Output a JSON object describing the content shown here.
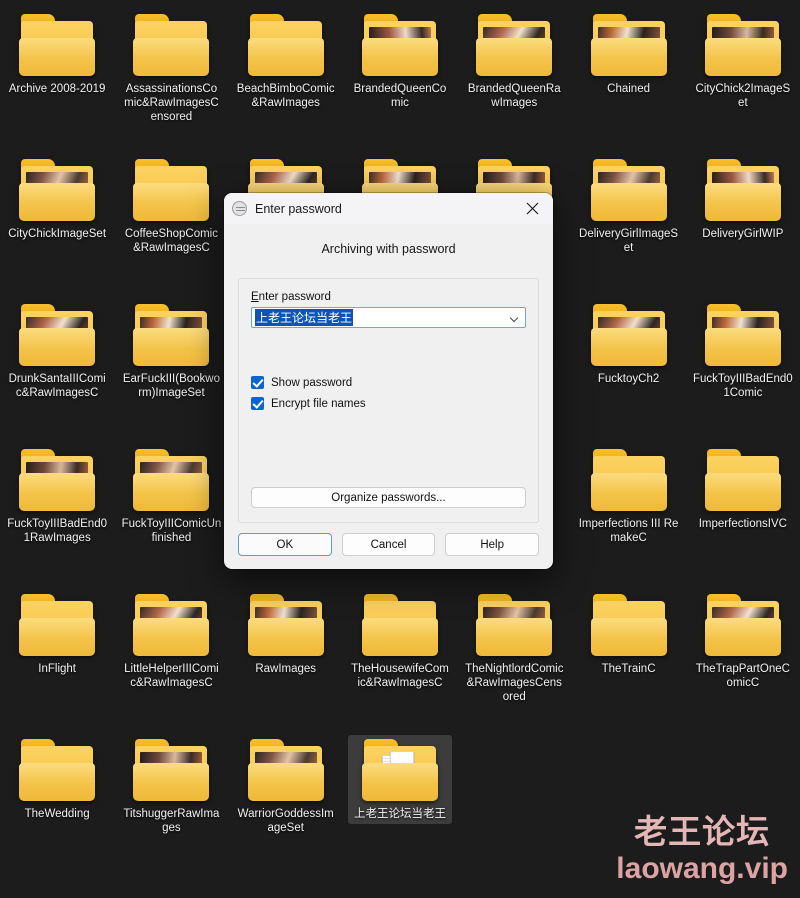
{
  "desktop": {
    "icons": [
      {
        "label": "Archive 2008-2019",
        "thumb": false,
        "selected": false
      },
      {
        "label": "AssassinationsComic&RawImagesCensored",
        "thumb": false,
        "selected": false
      },
      {
        "label": "BeachBimboComic&RawImages",
        "thumb": false,
        "selected": false
      },
      {
        "label": "BrandedQueenComic",
        "thumb": true,
        "selected": false
      },
      {
        "label": "BrandedQueenRawImages",
        "thumb": true,
        "selected": false
      },
      {
        "label": "Chained",
        "thumb": true,
        "selected": false
      },
      {
        "label": "CityChick2ImageSet",
        "thumb": true,
        "selected": false
      },
      {
        "label": "CityChickImageSet",
        "thumb": true,
        "selected": false
      },
      {
        "label": "CoffeeShopComic&RawImagesC",
        "thumb": false,
        "selected": false
      },
      {
        "label": "",
        "thumb": true,
        "selected": false
      },
      {
        "label": "",
        "thumb": true,
        "selected": false
      },
      {
        "label": "",
        "thumb": true,
        "selected": false
      },
      {
        "label": "DeliveryGirlImageSet",
        "thumb": true,
        "selected": false
      },
      {
        "label": "DeliveryGirlWIP",
        "thumb": true,
        "selected": false
      },
      {
        "label": "DrunkSantaIIIComic&RawImagesC",
        "thumb": true,
        "selected": false
      },
      {
        "label": "EarFuckIII(Bookworm)ImageSet",
        "thumb": true,
        "selected": false
      },
      {
        "label": "",
        "thumb": false,
        "selected": false
      },
      {
        "label": "",
        "thumb": false,
        "selected": false
      },
      {
        "label": "",
        "thumb": false,
        "selected": false
      },
      {
        "label": "FucktoyCh2",
        "thumb": true,
        "selected": false
      },
      {
        "label": "FuckToyIIIBadEnd01Comic",
        "thumb": true,
        "selected": false
      },
      {
        "label": "FuckToyIIIBadEnd01RawImages",
        "thumb": true,
        "selected": false
      },
      {
        "label": "FuckToyIIIComicUnfinished",
        "thumb": true,
        "selected": false
      },
      {
        "label": "",
        "thumb": false,
        "selected": false
      },
      {
        "label": "",
        "thumb": false,
        "selected": false
      },
      {
        "label": "",
        "thumb": false,
        "selected": false
      },
      {
        "label": "Imperfections III RemakeC",
        "thumb": false,
        "selected": false
      },
      {
        "label": "ImperfectionsIVC",
        "thumb": false,
        "selected": false
      },
      {
        "label": "InFlight",
        "thumb": false,
        "selected": false
      },
      {
        "label": "LittleHelperIIIComic&RawImagesC",
        "thumb": true,
        "selected": false
      },
      {
        "label": "RawImages",
        "thumb": true,
        "selected": false
      },
      {
        "label": "TheHousewifeComic&RawImagesC",
        "thumb": false,
        "selected": false
      },
      {
        "label": "TheNightlordComic&RawImagesCensored",
        "thumb": true,
        "selected": false
      },
      {
        "label": "TheTrainC",
        "thumb": false,
        "selected": false
      },
      {
        "label": "TheTrapPartOneComicC",
        "thumb": true,
        "selected": false
      },
      {
        "label": "TheWedding",
        "thumb": false,
        "selected": false
      },
      {
        "label": "TitshuggerRawImages",
        "thumb": true,
        "selected": false
      },
      {
        "label": "WarriorGoddessImageSet",
        "thumb": true,
        "selected": false
      },
      {
        "label": "上老王论坛当老王",
        "thumb": false,
        "docs": true,
        "selected": true
      }
    ]
  },
  "watermark": {
    "chinese": "老王论坛",
    "site": "laowang.vip",
    "color": "#e5b6b6"
  },
  "dialog": {
    "title": "Enter password",
    "title_icon": "winrar-icon",
    "close_icon": "close-icon",
    "heading": "Archiving with password",
    "field_label_prefix": "E",
    "field_label_rest": "nter password",
    "password_value": "上老王论坛当老王",
    "dropdown_icon": "chevron-down-icon",
    "checkboxes": [
      {
        "label": "Show password",
        "checked": true
      },
      {
        "label": "Encrypt file names",
        "checked": true
      }
    ],
    "organize_label": "Organize passwords...",
    "buttons": {
      "ok": "OK",
      "cancel": "Cancel",
      "help": "Help"
    },
    "accent": "#0b65d0"
  }
}
